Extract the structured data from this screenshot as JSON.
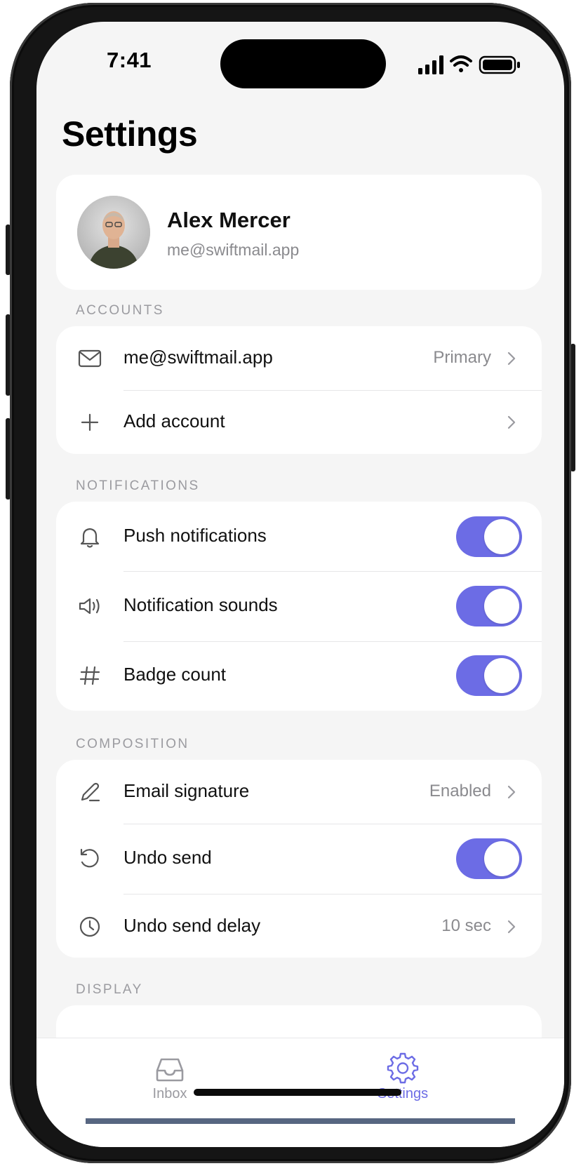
{
  "status_bar": {
    "time": "7:41"
  },
  "page": {
    "title": "Settings"
  },
  "profile": {
    "name": "Alex Mercer",
    "email": "me@swiftmail.app"
  },
  "sections": {
    "accounts": {
      "label": "ACCOUNTS",
      "rows": [
        {
          "icon": "mail-icon",
          "label": "me@swiftmail.app",
          "value": "Primary"
        },
        {
          "icon": "plus-icon",
          "label": "Add account",
          "value": ""
        }
      ]
    },
    "notifications": {
      "label": "NOTIFICATIONS",
      "rows": [
        {
          "icon": "bell-icon",
          "label": "Push notifications",
          "toggle_on": true
        },
        {
          "icon": "speaker-icon",
          "label": "Notification sounds",
          "toggle_on": true
        },
        {
          "icon": "hash-icon",
          "label": "Badge count",
          "toggle_on": true
        }
      ]
    },
    "composition": {
      "label": "COMPOSITION",
      "rows": [
        {
          "icon": "pencil-icon",
          "label": "Email signature",
          "value": "Enabled"
        },
        {
          "icon": "undo-icon",
          "label": "Undo send",
          "toggle_on": true
        },
        {
          "icon": "clock-icon",
          "label": "Undo send delay",
          "value": "10 sec"
        }
      ]
    },
    "display": {
      "label": "DISPLAY"
    }
  },
  "tabbar": {
    "items": [
      {
        "label": "Inbox",
        "icon": "inbox-icon",
        "active": false
      },
      {
        "label": "Settings",
        "icon": "gear-icon",
        "active": true
      }
    ]
  },
  "colors": {
    "accent": "#6c6ce5",
    "background": "#f5f5f5",
    "secondary_text": "#8a8a8e"
  }
}
